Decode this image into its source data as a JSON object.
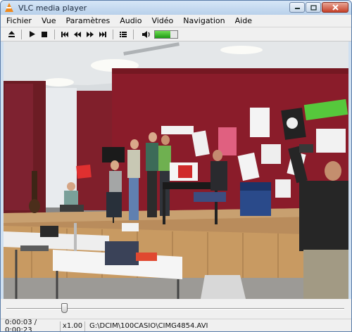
{
  "window": {
    "title": "VLC media player"
  },
  "menu": {
    "items": [
      "Fichier",
      "Vue",
      "Paramètres",
      "Audio",
      "Vidéo",
      "Navigation",
      "Aide"
    ]
  },
  "toolbar": {
    "buttons": [
      "eject-icon",
      "play-icon",
      "stop-icon",
      "skip-back-icon",
      "rewind-icon",
      "fast-forward-icon",
      "skip-forward-icon",
      "playlist-icon",
      "speaker-icon"
    ],
    "volume_level": 0.7
  },
  "player": {
    "position_fraction": 0.17
  },
  "status": {
    "time": "0:00:03 / 0:00:23",
    "speed": "x1.00",
    "path": "G:\\DCIM\\100CASIO\\CIMG4854.AVI"
  },
  "colors": {
    "accent_cone": "#f08a1c",
    "volume_fill": "#1d9a13",
    "wall": "#8a1c2a"
  }
}
